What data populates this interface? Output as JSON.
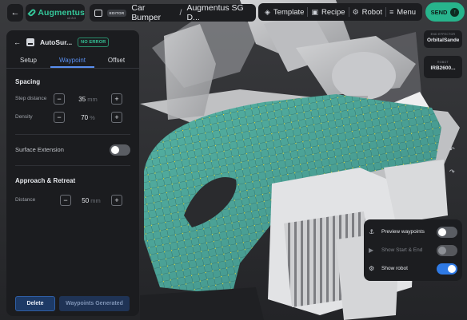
{
  "topbar": {
    "back_icon": "arrow-left-icon",
    "brand_name": "Augmentus",
    "brand_version": "v2.8.0",
    "editor_badge": "EDITOR",
    "project_name": "Car Bumper",
    "separator": "/",
    "workspace_name": "Augmentus SG D...",
    "template_label": "Template",
    "recipe_label": "Recipe",
    "robot_label": "Robot",
    "menu_label": "Menu",
    "send_label": "SEND"
  },
  "right_cards": {
    "end_effector_caption": "END EFFECTOR",
    "end_effector_value": "OrbitalSander",
    "robot_caption": "ROBOT",
    "robot_value": "IRB2600..."
  },
  "panel": {
    "title": "AutoSur...",
    "status": "NO ERROR",
    "tabs": [
      "Setup",
      "Waypoint",
      "Offset"
    ],
    "active_tab": "Waypoint",
    "spacing_title": "Spacing",
    "step_distance_label": "Step distance",
    "step_distance_value": "35",
    "step_distance_unit": "mm",
    "density_label": "Density",
    "density_value": "70",
    "density_unit": "%",
    "surface_extension_label": "Surface Extension",
    "surface_extension_on": false,
    "approach_title": "Approach & Retreat",
    "distance_label": "Distance",
    "distance_value": "50",
    "distance_unit": "mm",
    "minus": "−",
    "plus": "+",
    "delete_label": "Delete",
    "generate_label": "Waypoints Generated"
  },
  "display_options": {
    "preview_waypoints_label": "Preview waypoints",
    "preview_waypoints_on": false,
    "show_start_end_label": "Show Start & End",
    "show_start_end_enabled": false,
    "show_robot_label": "Show robot",
    "show_robot_on": true
  },
  "colors": {
    "brand": "#35c79a",
    "accent_blue": "#2f7ae5",
    "panel_bg": "#1b1c1f",
    "mesh_teal": "#4fa79a",
    "waypoint_yellow": "#e8e23a"
  }
}
